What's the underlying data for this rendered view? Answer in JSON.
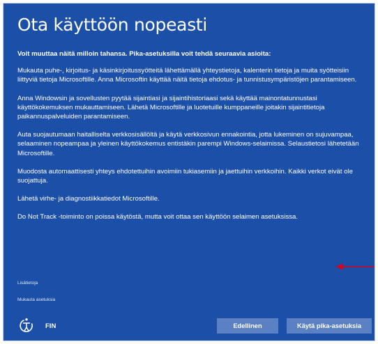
{
  "title": "Ota käyttöön nopeasti",
  "intro": "Voit muuttaa näitä milloin tahansa. Pika-asetuksilla voit tehdä seuraavia asioita:",
  "paragraphs": [
    "Mukauta puhe-, kirjoitus- ja käsinkirjoitussyötteitä lähettämällä yhteystietoja, kalenterin tietoja ja muita syötteisiin liittyviä tietoja Microsoftille. Anna Microsoftin käyttää näitä tietoja ehdotus- ja tunnistusympäristöjen parantamiseen.",
    "Anna Windowsin ja sovellusten pyytää sijaintiasi ja sijaintihistoriaasi sekä käyttää mainontatunnustasi käyttökokemuksen mukauttamiseen. Lähetä Microsoftille ja luotetuille kumppaneille joitakin sijaintitietoja paikannuspalveluiden parantamiseen.",
    "Auta suojautumaan haitalliselta verkkosisällöltä ja käytä verkkosivun ennakointia, jotta lukeminen on sujuvampaa, selaaminen nopeampaa ja yleinen käyttökokemus entistäkin parempi Windows-selaimissa. Selaustietosi lähetetään Microsoftille.",
    "Muodosta automaattisesti yhteys ehdotettuihin avoimiin tukiasemiin ja jaettuihin verkkoihin. Kaikki verkot eivät ole suojattuja.",
    "Lähetä virhe- ja diagnostiikkatiedot Microsoftille.",
    "Do Not Track -toiminto on poissa käytöstä, mutta voit ottaa sen käyttöön selaimen asetuksissa."
  ],
  "links": {
    "learn_more": "Lisätietoja",
    "customize": "Mukauta asetuksia"
  },
  "language": "FIN",
  "buttons": {
    "back": "Edellinen",
    "express": "Käytä pika-asetuksia"
  },
  "icons": {
    "accessibility": "ease-of-access-icon",
    "annotation": "red-arrow"
  },
  "colors": {
    "background": "#1c4fa8",
    "button": "#5b80c4",
    "arrow": "#d8001e"
  }
}
